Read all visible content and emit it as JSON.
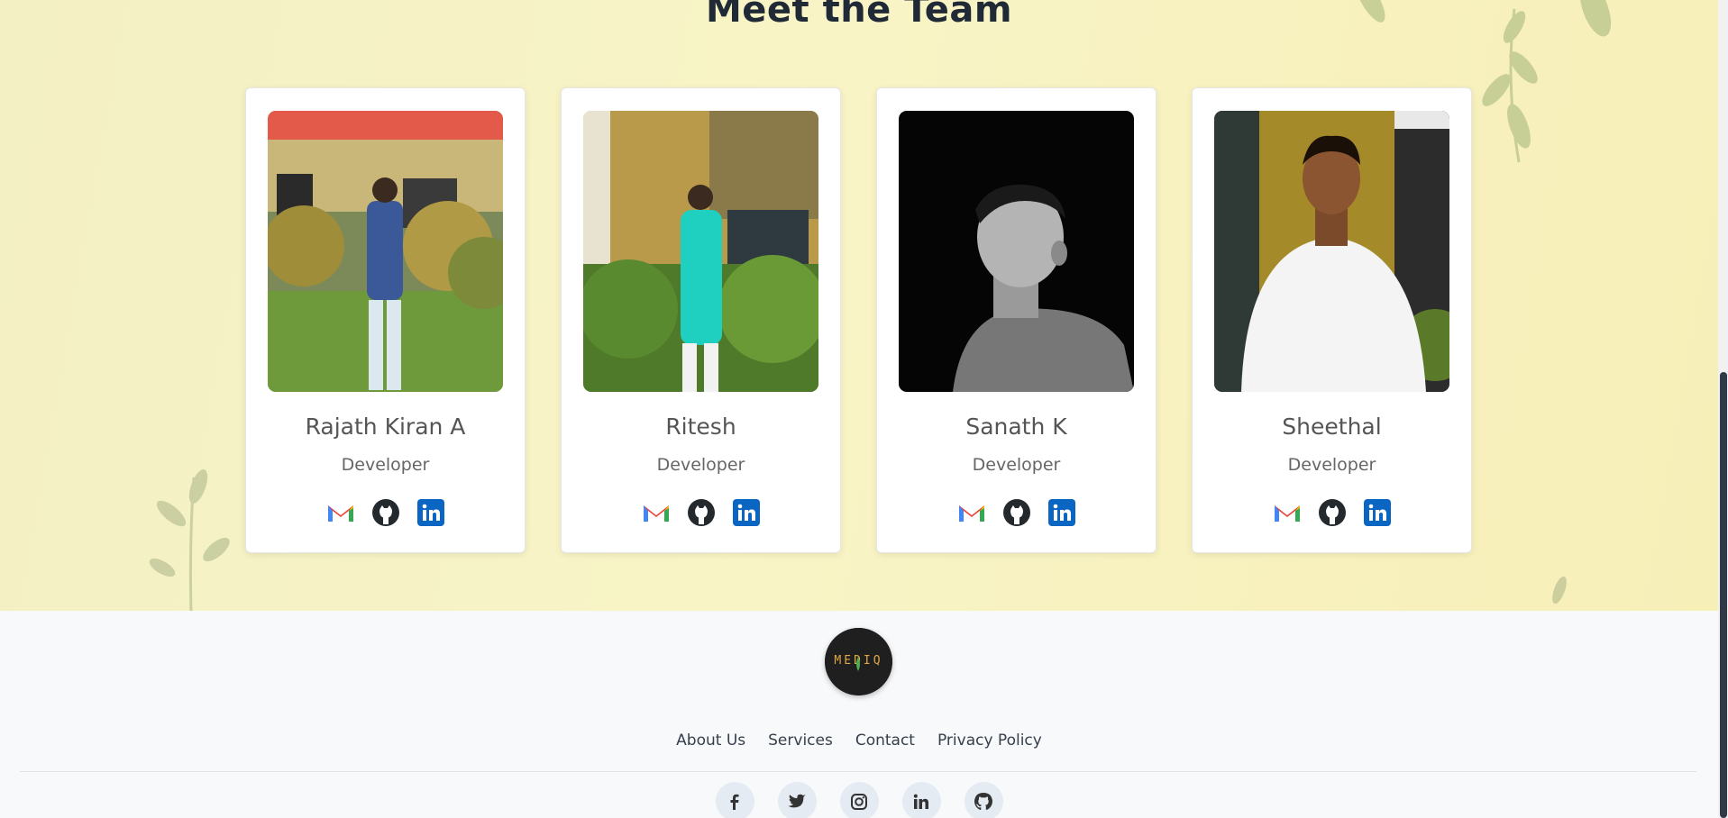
{
  "section": {
    "title": "Meet the Team"
  },
  "team": [
    {
      "name": "Rajath Kiran A",
      "role": "Developer"
    },
    {
      "name": "Ritesh",
      "role": "Developer"
    },
    {
      "name": "Sanath K",
      "role": "Developer"
    },
    {
      "name": "Sheethal",
      "role": "Developer"
    }
  ],
  "member_icons": [
    "gmail-icon",
    "github-icon",
    "linkedin-icon"
  ],
  "footer": {
    "logo_text": "MEDIQ",
    "links": [
      "About Us",
      "Services",
      "Contact",
      "Privacy Policy"
    ],
    "social_icons": [
      "facebook-icon",
      "twitter-icon",
      "instagram-icon",
      "linkedin-icon",
      "github-icon"
    ]
  },
  "colors": {
    "linkedin": "#0a66c2",
    "gmail_red": "#ea4335",
    "footer_bg": "#f8f9fb",
    "hero_bg": "#f6f2c0"
  }
}
